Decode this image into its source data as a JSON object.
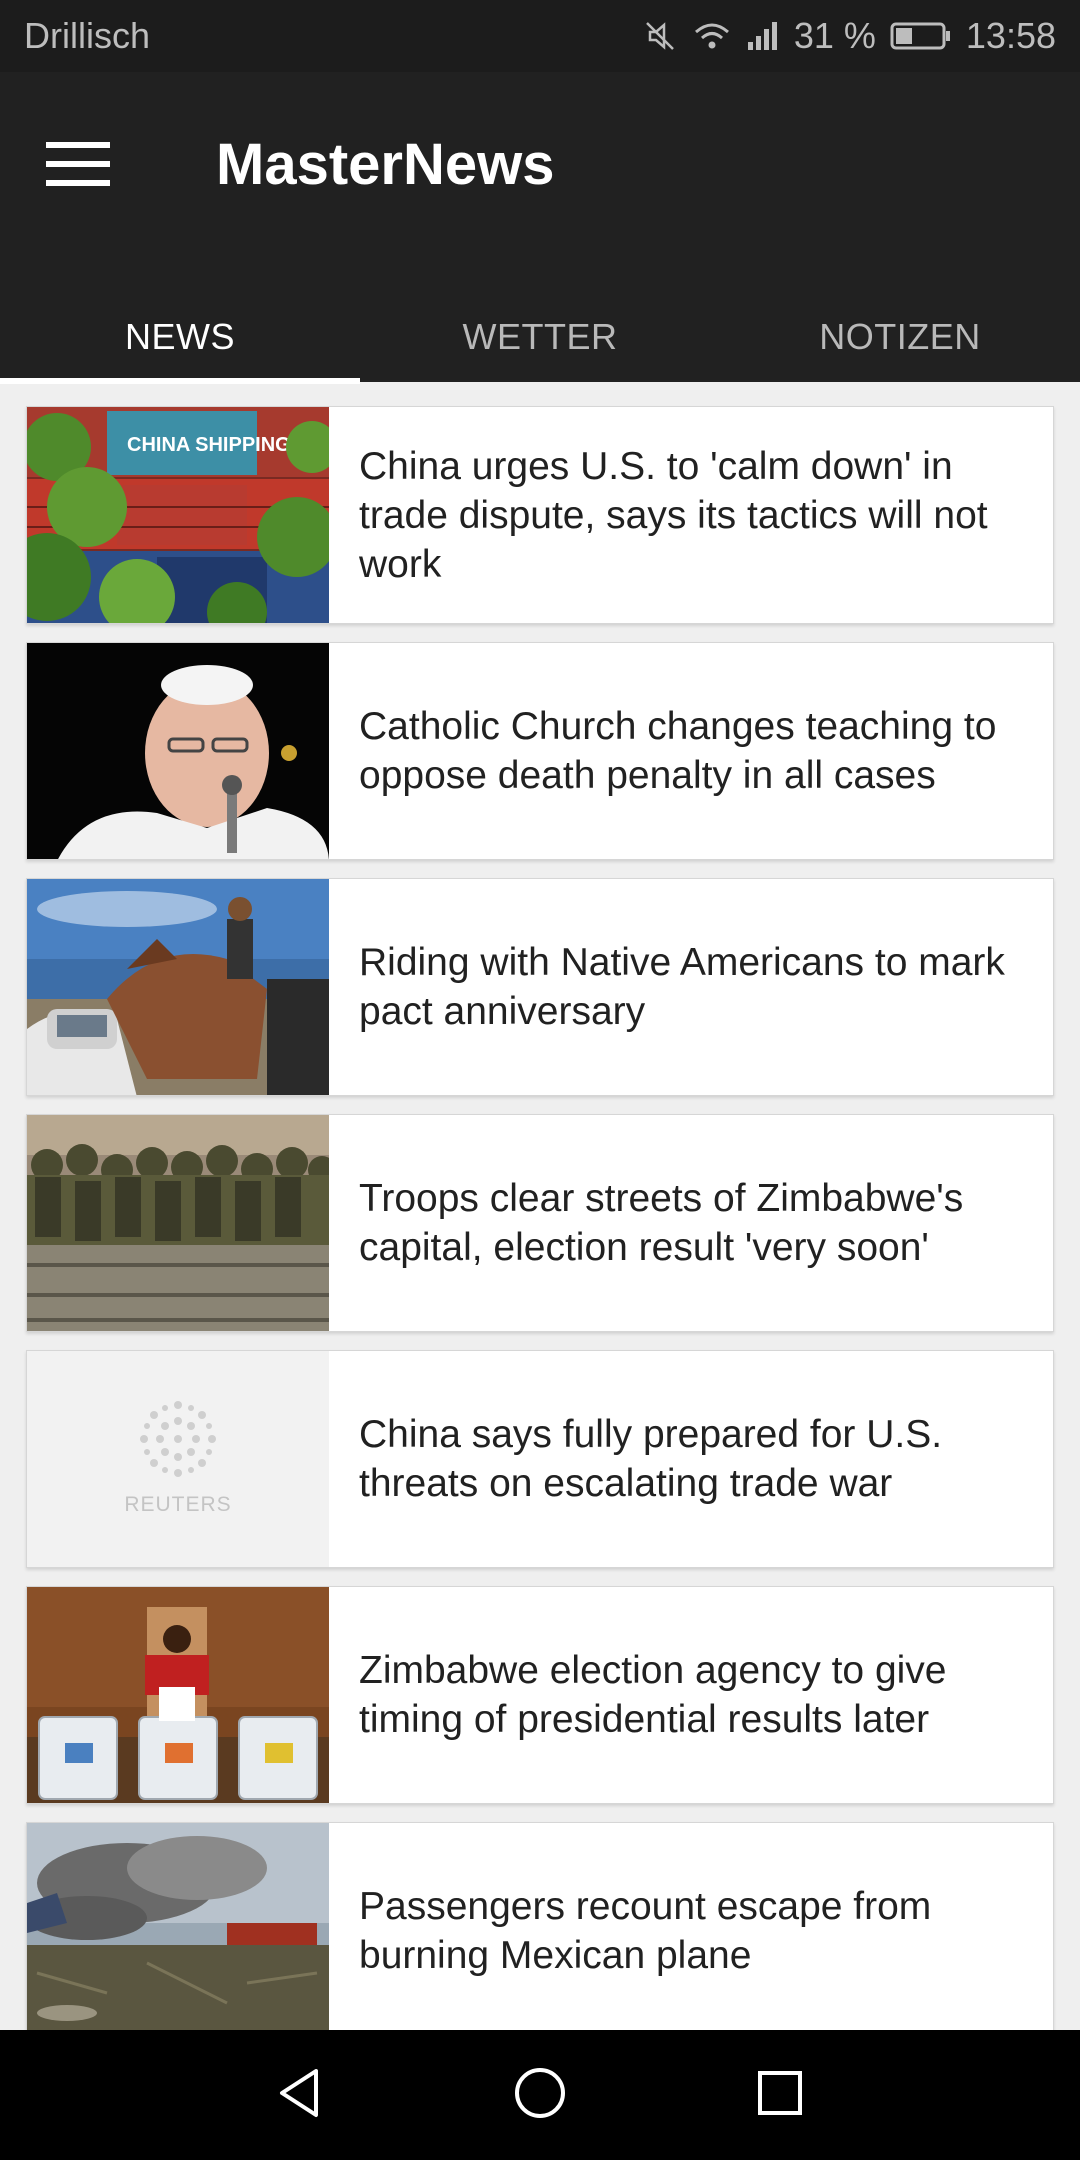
{
  "status_bar": {
    "carrier": "Drillisch",
    "battery_percent": "31 %",
    "time": "13:58",
    "icons": [
      "mute-icon",
      "wifi-icon",
      "signal-icon",
      "battery-icon"
    ]
  },
  "app": {
    "title": "MasterNews",
    "menu_icon": "hamburger-menu-icon",
    "colors": {
      "appbar": "#212121",
      "tab_indicator": "#ffffff",
      "text": "#212121"
    }
  },
  "tabs": [
    {
      "label": "NEWS",
      "active": true
    },
    {
      "label": "WETTER",
      "active": false
    },
    {
      "label": "NOTIZEN",
      "active": false
    }
  ],
  "articles": [
    {
      "headline": "China urges U.S. to 'calm down' in trade dispute, says its tactics will not work",
      "thumbnail": "shipping-containers"
    },
    {
      "headline": "Catholic Church changes teaching to oppose death penalty in all cases",
      "thumbnail": "pope-portrait"
    },
    {
      "headline": "Riding with Native Americans to mark pact anniversary",
      "thumbnail": "horse-riders"
    },
    {
      "headline": "Troops clear streets of Zimbabwe's capital, election result 'very soon'",
      "thumbnail": "troops-truck"
    },
    {
      "headline": "China says fully prepared for U.S. threats on escalating trade war",
      "thumbnail": "reuters-placeholder",
      "thumbnail_text": "REUTERS"
    },
    {
      "headline": "Zimbabwe election agency to give timing of presidential results later",
      "thumbnail": "ballot-boxes"
    },
    {
      "headline": "Passengers recount escape from burning Mexican plane",
      "thumbnail": "plane-smoke"
    }
  ],
  "nav_bar": [
    "back-icon",
    "home-icon",
    "recents-icon"
  ]
}
